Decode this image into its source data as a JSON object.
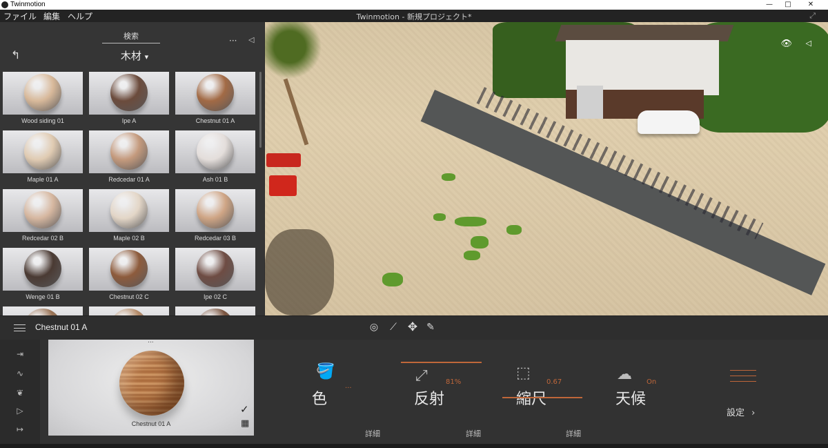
{
  "window": {
    "app_name": "Twinmotion",
    "minimize": "—",
    "maximize": "□",
    "close": "✕"
  },
  "menu": {
    "items": [
      "ファイル",
      "編集",
      "ヘルプ"
    ],
    "project_title": "Twinmotion - 新規プロジェクト*"
  },
  "library": {
    "search_label": "検索",
    "category": "木材",
    "category_caret": "▾",
    "more": "···",
    "back_icon": "back-arrow-icon",
    "materials": [
      {
        "name": "Wood siding 01",
        "color": "#d8b99a"
      },
      {
        "name": "Ipe A",
        "color": "#6b4b3c"
      },
      {
        "name": "Chestnut 01 A",
        "color": "#a26a45"
      },
      {
        "name": "Maple 01 A",
        "color": "#e0cbb2"
      },
      {
        "name": "Redcedar 01 A",
        "color": "#c49a7d"
      },
      {
        "name": "Ash 01 B",
        "color": "#e4dedb"
      },
      {
        "name": "Redcedar 02 B",
        "color": "#d6b7a0"
      },
      {
        "name": "Maple 02 B",
        "color": "#e3d6c7"
      },
      {
        "name": "Redcedar 03 B",
        "color": "#cfa585"
      },
      {
        "name": "Wenge 01 B",
        "color": "#4a3a33"
      },
      {
        "name": "Chestnut 02 C",
        "color": "#8d5b3c"
      },
      {
        "name": "Ipe 02 C",
        "color": "#6e4c43"
      },
      {
        "name": "",
        "color": "#9a7355"
      },
      {
        "name": "",
        "color": "#b58b68"
      },
      {
        "name": "",
        "color": "#7b5540"
      }
    ]
  },
  "viewport": {
    "eye_icon": "eye-icon",
    "collapse": "◁"
  },
  "toolbar": {
    "selected_material": "Chestnut 01 A",
    "tools": [
      "select-icon",
      "paint-icon",
      "move-icon",
      "eyedropper-icon"
    ]
  },
  "bottom": {
    "preview_label": "Chestnut 01 A",
    "preview_dots": "...",
    "side_icons": [
      "import-icon",
      "waveform-icon",
      "leaf-icon",
      "media-icon",
      "export-icon"
    ],
    "properties": [
      {
        "name": "色",
        "value": "..."
      },
      {
        "name": "反射",
        "value": "81%"
      },
      {
        "name": "縮尺",
        "value": "0.67"
      },
      {
        "name": "天候",
        "value": "On"
      }
    ],
    "detail_label": "詳細",
    "settings_label": "設定",
    "accent_color": "#c0673a"
  }
}
